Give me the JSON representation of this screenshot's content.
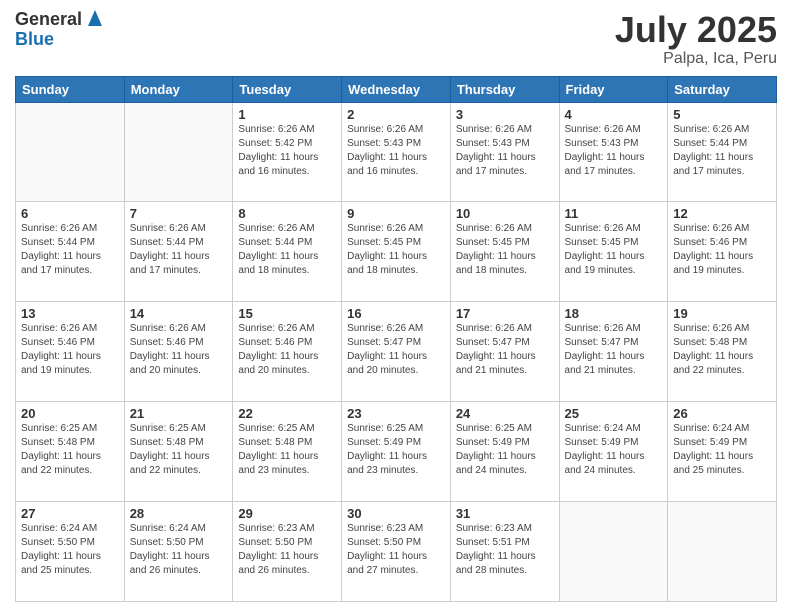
{
  "header": {
    "logo_general": "General",
    "logo_blue": "Blue",
    "month_year": "July 2025",
    "location": "Palpa, Ica, Peru"
  },
  "weekdays": [
    "Sunday",
    "Monday",
    "Tuesday",
    "Wednesday",
    "Thursday",
    "Friday",
    "Saturday"
  ],
  "weeks": [
    [
      {
        "day": "",
        "info": ""
      },
      {
        "day": "",
        "info": ""
      },
      {
        "day": "1",
        "info": "Sunrise: 6:26 AM\nSunset: 5:42 PM\nDaylight: 11 hours and 16 minutes."
      },
      {
        "day": "2",
        "info": "Sunrise: 6:26 AM\nSunset: 5:43 PM\nDaylight: 11 hours and 16 minutes."
      },
      {
        "day": "3",
        "info": "Sunrise: 6:26 AM\nSunset: 5:43 PM\nDaylight: 11 hours and 17 minutes."
      },
      {
        "day": "4",
        "info": "Sunrise: 6:26 AM\nSunset: 5:43 PM\nDaylight: 11 hours and 17 minutes."
      },
      {
        "day": "5",
        "info": "Sunrise: 6:26 AM\nSunset: 5:44 PM\nDaylight: 11 hours and 17 minutes."
      }
    ],
    [
      {
        "day": "6",
        "info": "Sunrise: 6:26 AM\nSunset: 5:44 PM\nDaylight: 11 hours and 17 minutes."
      },
      {
        "day": "7",
        "info": "Sunrise: 6:26 AM\nSunset: 5:44 PM\nDaylight: 11 hours and 17 minutes."
      },
      {
        "day": "8",
        "info": "Sunrise: 6:26 AM\nSunset: 5:44 PM\nDaylight: 11 hours and 18 minutes."
      },
      {
        "day": "9",
        "info": "Sunrise: 6:26 AM\nSunset: 5:45 PM\nDaylight: 11 hours and 18 minutes."
      },
      {
        "day": "10",
        "info": "Sunrise: 6:26 AM\nSunset: 5:45 PM\nDaylight: 11 hours and 18 minutes."
      },
      {
        "day": "11",
        "info": "Sunrise: 6:26 AM\nSunset: 5:45 PM\nDaylight: 11 hours and 19 minutes."
      },
      {
        "day": "12",
        "info": "Sunrise: 6:26 AM\nSunset: 5:46 PM\nDaylight: 11 hours and 19 minutes."
      }
    ],
    [
      {
        "day": "13",
        "info": "Sunrise: 6:26 AM\nSunset: 5:46 PM\nDaylight: 11 hours and 19 minutes."
      },
      {
        "day": "14",
        "info": "Sunrise: 6:26 AM\nSunset: 5:46 PM\nDaylight: 11 hours and 20 minutes."
      },
      {
        "day": "15",
        "info": "Sunrise: 6:26 AM\nSunset: 5:46 PM\nDaylight: 11 hours and 20 minutes."
      },
      {
        "day": "16",
        "info": "Sunrise: 6:26 AM\nSunset: 5:47 PM\nDaylight: 11 hours and 20 minutes."
      },
      {
        "day": "17",
        "info": "Sunrise: 6:26 AM\nSunset: 5:47 PM\nDaylight: 11 hours and 21 minutes."
      },
      {
        "day": "18",
        "info": "Sunrise: 6:26 AM\nSunset: 5:47 PM\nDaylight: 11 hours and 21 minutes."
      },
      {
        "day": "19",
        "info": "Sunrise: 6:26 AM\nSunset: 5:48 PM\nDaylight: 11 hours and 22 minutes."
      }
    ],
    [
      {
        "day": "20",
        "info": "Sunrise: 6:25 AM\nSunset: 5:48 PM\nDaylight: 11 hours and 22 minutes."
      },
      {
        "day": "21",
        "info": "Sunrise: 6:25 AM\nSunset: 5:48 PM\nDaylight: 11 hours and 22 minutes."
      },
      {
        "day": "22",
        "info": "Sunrise: 6:25 AM\nSunset: 5:48 PM\nDaylight: 11 hours and 23 minutes."
      },
      {
        "day": "23",
        "info": "Sunrise: 6:25 AM\nSunset: 5:49 PM\nDaylight: 11 hours and 23 minutes."
      },
      {
        "day": "24",
        "info": "Sunrise: 6:25 AM\nSunset: 5:49 PM\nDaylight: 11 hours and 24 minutes."
      },
      {
        "day": "25",
        "info": "Sunrise: 6:24 AM\nSunset: 5:49 PM\nDaylight: 11 hours and 24 minutes."
      },
      {
        "day": "26",
        "info": "Sunrise: 6:24 AM\nSunset: 5:49 PM\nDaylight: 11 hours and 25 minutes."
      }
    ],
    [
      {
        "day": "27",
        "info": "Sunrise: 6:24 AM\nSunset: 5:50 PM\nDaylight: 11 hours and 25 minutes."
      },
      {
        "day": "28",
        "info": "Sunrise: 6:24 AM\nSunset: 5:50 PM\nDaylight: 11 hours and 26 minutes."
      },
      {
        "day": "29",
        "info": "Sunrise: 6:23 AM\nSunset: 5:50 PM\nDaylight: 11 hours and 26 minutes."
      },
      {
        "day": "30",
        "info": "Sunrise: 6:23 AM\nSunset: 5:50 PM\nDaylight: 11 hours and 27 minutes."
      },
      {
        "day": "31",
        "info": "Sunrise: 6:23 AM\nSunset: 5:51 PM\nDaylight: 11 hours and 28 minutes."
      },
      {
        "day": "",
        "info": ""
      },
      {
        "day": "",
        "info": ""
      }
    ]
  ]
}
